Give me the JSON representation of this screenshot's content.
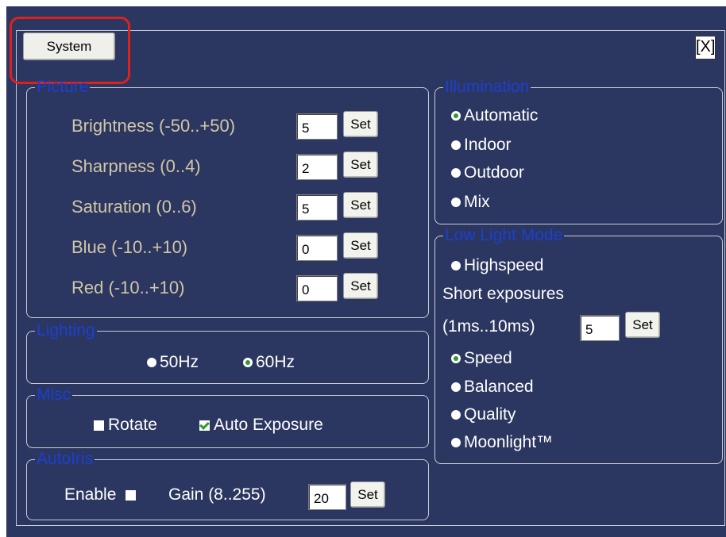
{
  "header": {
    "system_label": "System",
    "close_label": "[X]"
  },
  "picture": {
    "legend": "Picture",
    "rows": [
      {
        "label": "Brightness (-50..+50)",
        "value": "5",
        "set": "Set"
      },
      {
        "label": "Sharpness (0..4)",
        "value": "2",
        "set": "Set"
      },
      {
        "label": "Saturation (0..6)",
        "value": "5",
        "set": "Set"
      },
      {
        "label": "Blue (-10..+10)",
        "value": "0",
        "set": "Set"
      },
      {
        "label": "Red (-10..+10)",
        "value": "0",
        "set": "Set"
      }
    ]
  },
  "lighting": {
    "legend": "Lighting",
    "options": [
      {
        "label": "50Hz",
        "checked": false
      },
      {
        "label": "60Hz",
        "checked": true
      }
    ]
  },
  "misc": {
    "legend": "Misc",
    "rotate_label": "Rotate",
    "rotate_checked": false,
    "auto_exposure_label": "Auto Exposure",
    "auto_exposure_checked": true
  },
  "autoiris": {
    "legend": "AutoIris",
    "enable_label": "Enable",
    "enable_checked": false,
    "gain_label": "Gain (8..255)",
    "gain_value": "20",
    "set": "Set"
  },
  "illumination": {
    "legend": "Illumination",
    "options": [
      {
        "label": "Automatic",
        "checked": true
      },
      {
        "label": "Indoor",
        "checked": false
      },
      {
        "label": "Outdoor",
        "checked": false
      },
      {
        "label": "Mix",
        "checked": false
      }
    ]
  },
  "lowlight": {
    "legend": "Low Light Mode",
    "highspeed_label": "Highspeed",
    "short_exposures_label": "Short exposures",
    "range_label": "(1ms..10ms)",
    "exposure_value": "5",
    "set": "Set",
    "options": [
      {
        "label": "Speed",
        "checked": true
      },
      {
        "label": "Balanced",
        "checked": false
      },
      {
        "label": "Quality",
        "checked": false
      },
      {
        "label": "Moonlight™",
        "checked": false
      }
    ]
  }
}
